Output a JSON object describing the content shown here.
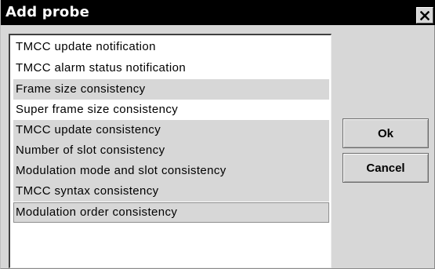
{
  "window": {
    "title": "Add probe",
    "close_icon": "close-icon"
  },
  "probe_list": {
    "items": [
      {
        "label": "TMCC update notification",
        "selected": false
      },
      {
        "label": "TMCC alarm status notification",
        "selected": false
      },
      {
        "label": "Frame size consistency",
        "selected": true
      },
      {
        "label": "Super frame size consistency",
        "selected": false
      },
      {
        "label": "TMCC update consistency",
        "selected": true
      },
      {
        "label": "Number of slot consistency",
        "selected": true
      },
      {
        "label": "Modulation mode and slot consistency",
        "selected": true
      },
      {
        "label": "TMCC syntax consistency",
        "selected": true
      },
      {
        "label": "Modulation order consistency",
        "selected": true,
        "focused": true
      }
    ]
  },
  "buttons": {
    "ok_label": "Ok",
    "cancel_label": "Cancel"
  },
  "colors": {
    "title_bar": "#000000",
    "title_text": "#ffffff",
    "dialog_background": "#d7d7d7",
    "list_background": "#ffffff",
    "selected_row": "#d7d7d7"
  }
}
